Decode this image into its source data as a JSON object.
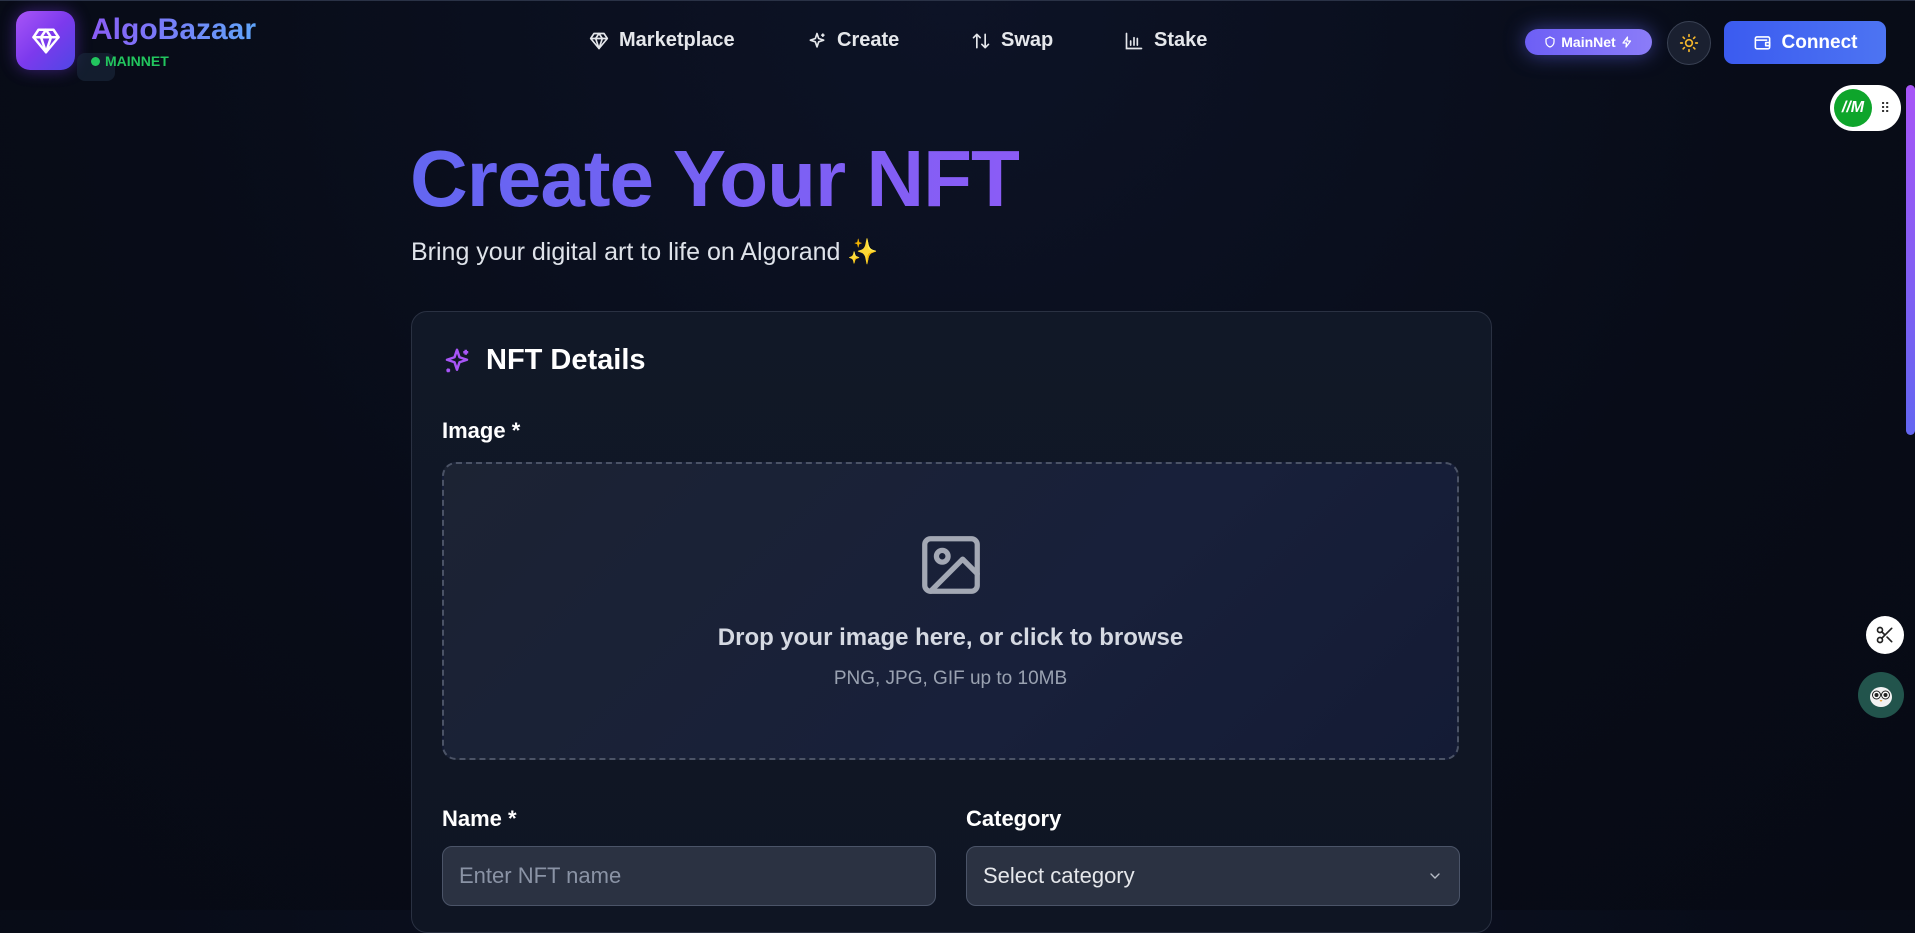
{
  "header": {
    "brand": "AlgoBazaar",
    "network_status": "MAINNET",
    "nav": [
      {
        "label": "Marketplace",
        "icon": "gem-icon"
      },
      {
        "label": "Create",
        "icon": "sparkles-icon"
      },
      {
        "label": "Swap",
        "icon": "swap-arrows-icon"
      },
      {
        "label": "Stake",
        "icon": "bar-chart-icon"
      }
    ],
    "network_pill": "MainNet",
    "connect_label": "Connect"
  },
  "extension": {
    "logo_text": "//M"
  },
  "hero": {
    "title": "Create Your NFT",
    "subtitle": "Bring your digital art to life on Algorand ✨"
  },
  "form": {
    "card_title": "NFT Details",
    "image_label": "Image *",
    "dropzone_title": "Drop your image here, or click to browse",
    "dropzone_hint": "PNG, JPG, GIF up to 10MB",
    "name_label": "Name *",
    "name_placeholder": "Enter NFT name",
    "category_label": "Category",
    "category_value": "Select category"
  },
  "colors": {
    "accent_start": "#6366f1",
    "accent_end": "#8b5cf6",
    "status_green": "#22c55e",
    "connect_button": "#3b5bf0"
  }
}
